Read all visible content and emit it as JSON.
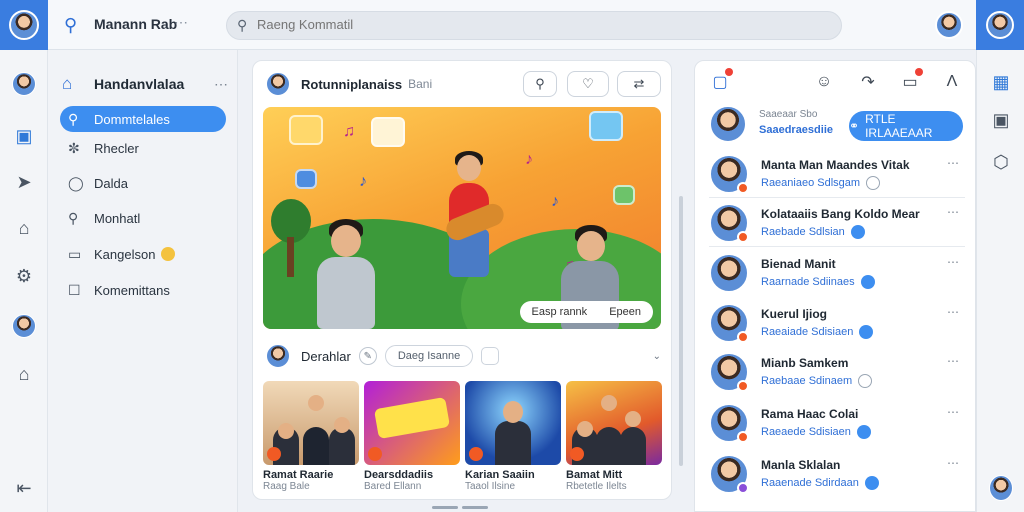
{
  "header": {
    "title": "Manann Rab",
    "search_placeholder": "Raeng Kommatil"
  },
  "nav": {
    "heading": "Handanvlalaa",
    "items": [
      {
        "label": "Dommtelales",
        "icon": "search-icon",
        "active": true
      },
      {
        "label": "Rhecler",
        "icon": "puzzle-icon"
      },
      {
        "label": "Dalda",
        "icon": "chat-icon"
      },
      {
        "label": "Monhatl",
        "icon": "search-icon"
      },
      {
        "label": "Kangelson",
        "icon": "message-icon"
      },
      {
        "label": "Komemittans",
        "icon": "checkbox-icon"
      }
    ]
  },
  "post": {
    "author": "Rotunniplanaiss",
    "author_sub": "Bani",
    "hero_pills": [
      "Easp rannk",
      "Epeen"
    ],
    "comment_author": "Derahlar",
    "comment_pill": "Daeg Isanne",
    "thumbnails": [
      {
        "title": "Ramat Raarie",
        "sub": "Raag Bale"
      },
      {
        "title": "Dearsddadiis",
        "sub": "Bared Ellann"
      },
      {
        "title": "Karian Saaiin",
        "sub": "Taaol Ilsine"
      },
      {
        "title": "Bamat Mitt",
        "sub": "Rbetetle Ilelts"
      }
    ]
  },
  "right": {
    "featured": {
      "line1": "Saaeaar Sbo",
      "line2": "Saaedraesdiie",
      "button": "RTLE IRLAAEAAR"
    },
    "people": [
      {
        "name": "Manta Man Maandes Vitak",
        "sub": "Raeaniaeo Sdlsgam",
        "check": "grey"
      },
      {
        "name": "Kolataaiis Bang Koldo Mear",
        "sub": "Raebade Sdlsian",
        "check": "blue"
      },
      {
        "name": "Bienad Manit",
        "sub": "Raarnade Sdiinaes",
        "check": "blue"
      },
      {
        "name": "Kuerul Ijiog",
        "sub": "Raeaiade Sdisiaen",
        "check": "blue"
      },
      {
        "name": "Mianb Samkem",
        "sub": "Raebaae Sdinaem",
        "check": "grey"
      },
      {
        "name": "Rama Haac Colai",
        "sub": "Raeaede Sdisiaen",
        "check": "blue"
      },
      {
        "name": "Manla Sklalan",
        "sub": "Raaenade Sdirdaan",
        "check": "blue"
      }
    ]
  },
  "colors": {
    "accent": "#3d8ef0",
    "rail_blue": "#3a7de0",
    "live": "#f15a24"
  }
}
